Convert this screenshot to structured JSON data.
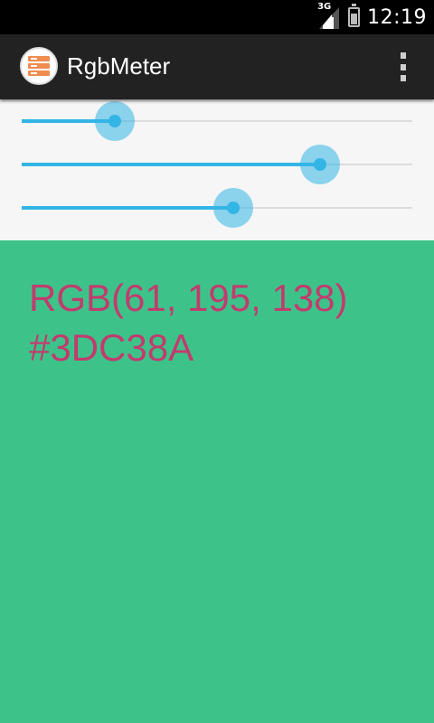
{
  "status_bar": {
    "network_type": "3G",
    "time": "12:19"
  },
  "action_bar": {
    "title": "RgbMeter",
    "app_icon": "server-stack-icon",
    "overflow_icon": "overflow-menu-icon",
    "app_icon_color": "#f08c50"
  },
  "sliders": {
    "red": {
      "value": 61,
      "max": 255
    },
    "green": {
      "value": 195,
      "max": 255
    },
    "blue": {
      "value": 138,
      "max": 255
    },
    "accent_color": "#33b5e5"
  },
  "color_display": {
    "rgb_label": "RGB(61, 195, 138)",
    "hex_label": "#3DC38A",
    "background_color": "#3dc38a",
    "text_color": "#c23b6e"
  }
}
